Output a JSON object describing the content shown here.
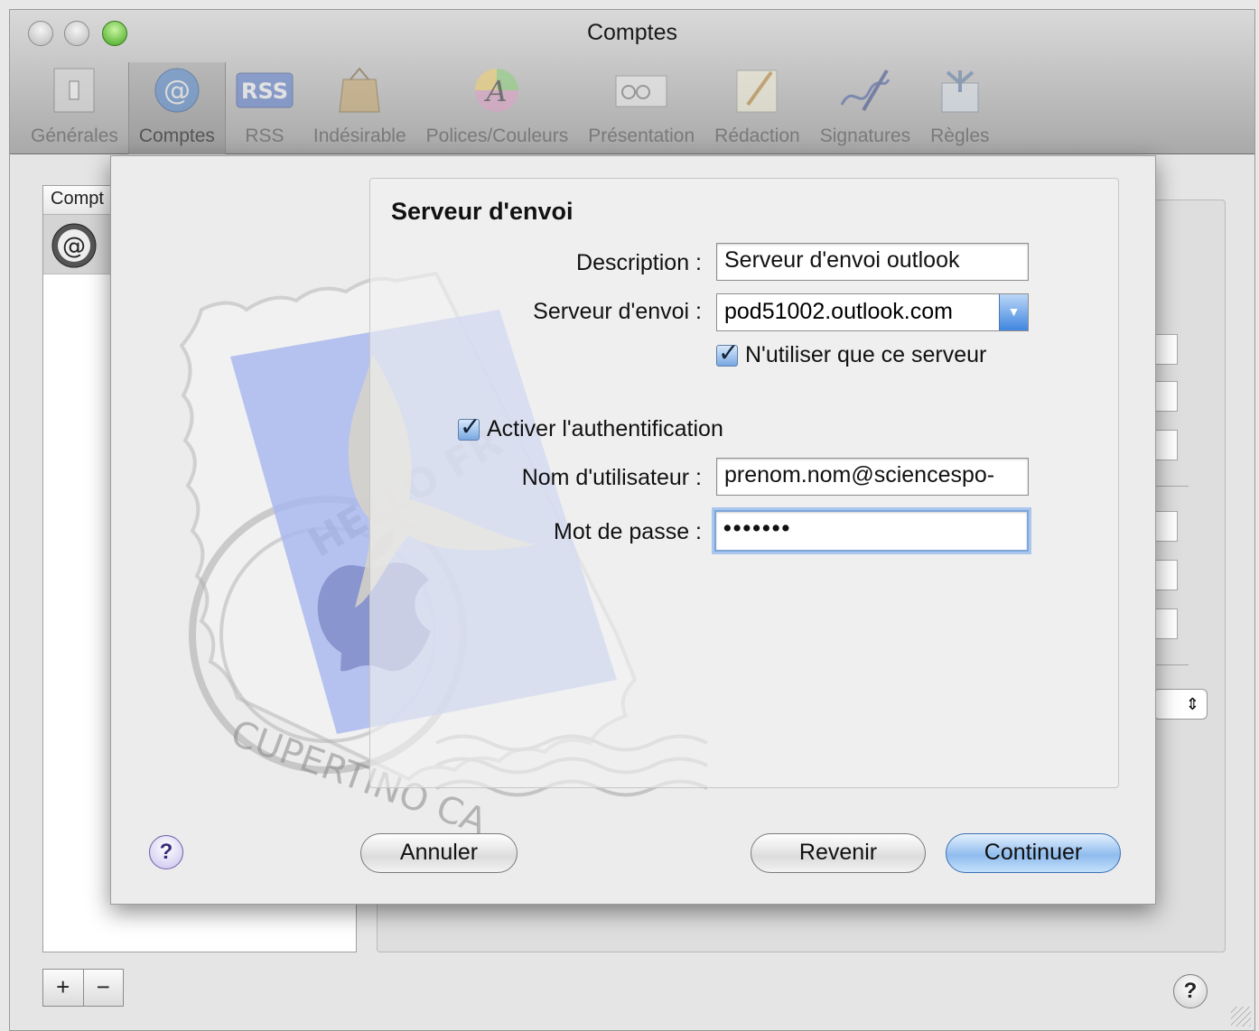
{
  "window": {
    "title": "Comptes"
  },
  "toolbar": {
    "items": [
      {
        "label": "Générales",
        "icon": "switch-icon"
      },
      {
        "label": "Comptes",
        "icon": "at-sign-icon",
        "selected": true
      },
      {
        "label": "RSS",
        "icon": "rss-icon"
      },
      {
        "label": "Indésirable",
        "icon": "junk-bag-icon"
      },
      {
        "label": "Polices/Couleurs",
        "icon": "font-colors-icon"
      },
      {
        "label": "Présentation",
        "icon": "viewing-icon"
      },
      {
        "label": "Rédaction",
        "icon": "composing-icon"
      },
      {
        "label": "Signatures",
        "icon": "signature-icon"
      },
      {
        "label": "Règles",
        "icon": "rules-icon"
      }
    ]
  },
  "accounts_list": {
    "header": "Compt"
  },
  "sheet": {
    "title": "Serveur d'envoi",
    "description": {
      "label": "Description :",
      "value": "Serveur d'envoi outlook"
    },
    "server": {
      "label": "Serveur d'envoi :",
      "value": "pod51002.outlook.com"
    },
    "only_server": {
      "label": "N'utiliser que ce serveur",
      "checked": true
    },
    "auth": {
      "label": "Activer l'authentification",
      "checked": true
    },
    "username": {
      "label": "Nom d'utilisateur :",
      "value": "prenom.nom@sciencespo-"
    },
    "password": {
      "label": "Mot de passe :",
      "value": "•••••••"
    },
    "buttons": {
      "cancel": "Annuler",
      "back": "Revenir",
      "continue": "Continuer"
    },
    "help": "?"
  },
  "bottom": {
    "add": "+",
    "remove": "−",
    "help": "?"
  },
  "colors": {
    "accent": "#3f86e0",
    "focus_ring": "#a9c7ee"
  }
}
